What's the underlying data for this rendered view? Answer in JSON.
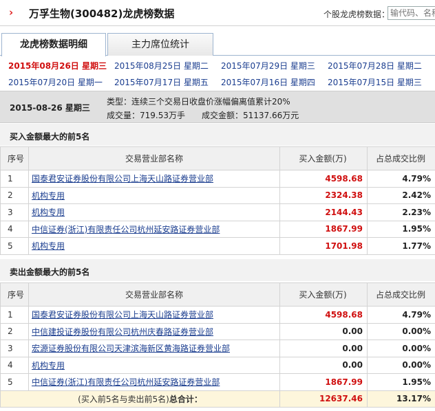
{
  "header": {
    "arrow": "›",
    "stock_name": "万孚生物",
    "stock_code": "(300482)",
    "page_title_suffix": "龙虎榜数据",
    "search_label": "个股龙虎榜数据：",
    "search_placeholder": "输代码、名称"
  },
  "tabs": [
    {
      "label": "龙虎榜数据明细"
    },
    {
      "label": "主力席位统计"
    }
  ],
  "dates": [
    {
      "date": "2015年08月26日",
      "weekday": "星期三"
    },
    {
      "date": "2015年08月25日",
      "weekday": "星期二"
    },
    {
      "date": "2015年07月29日",
      "weekday": "星期三"
    },
    {
      "date": "2015年07月28日",
      "weekday": "星期二"
    },
    {
      "date": "2015年07月20日",
      "weekday": "星期一"
    },
    {
      "date": "2015年07月17日",
      "weekday": "星期五"
    },
    {
      "date": "2015年07月16日",
      "weekday": "星期四"
    },
    {
      "date": "2015年07月15日",
      "weekday": "星期三"
    }
  ],
  "summary": {
    "date": "2015-08-26  星期三",
    "type": "类型：连续三个交易日收盘价涨幅偏离值累计20%",
    "volume": "成交量：719.53万手",
    "amount": "成交金额：51137.66万元"
  },
  "buy": {
    "title": "买入金额最大的前5名",
    "columns": [
      "序号",
      "交易营业部名称",
      "买入金额(万)",
      "占总成交比例"
    ],
    "rows": [
      {
        "idx": "1",
        "name": "国泰君安证券股份有限公司上海天山路证券营业部",
        "amount": "4598.68",
        "pct": "4.79%"
      },
      {
        "idx": "2",
        "name": "机构专用",
        "amount": "2324.38",
        "pct": "2.42%"
      },
      {
        "idx": "3",
        "name": "机构专用",
        "amount": "2144.43",
        "pct": "2.23%"
      },
      {
        "idx": "4",
        "name": "中信证券(浙江)有限责任公司杭州延安路证券营业部",
        "amount": "1867.99",
        "pct": "1.95%"
      },
      {
        "idx": "5",
        "name": "机构专用",
        "amount": "1701.98",
        "pct": "1.77%"
      }
    ]
  },
  "sell": {
    "title": "卖出金额最大的前5名",
    "columns": [
      "序号",
      "交易营业部名称",
      "买入金额(万)",
      "占总成交比例"
    ],
    "rows": [
      {
        "idx": "1",
        "name": "国泰君安证券股份有限公司上海天山路证券营业部",
        "amount": "4598.68",
        "pct": "4.79%"
      },
      {
        "idx": "2",
        "name": "中信建投证券股份有限公司杭州庆春路证券营业部",
        "amount": "0.00",
        "pct": "0.00%"
      },
      {
        "idx": "3",
        "name": "宏源证券股份有限公司天津滨海新区黄海路证券营业部",
        "amount": "0.00",
        "pct": "0.00%"
      },
      {
        "idx": "4",
        "name": "机构专用",
        "amount": "0.00",
        "pct": "0.00%"
      },
      {
        "idx": "5",
        "name": "中信证券(浙江)有限责任公司杭州延安路证券营业部",
        "amount": "1867.99",
        "pct": "1.95%"
      }
    ],
    "total_prefix": "(买入前5名与卖出前5名)",
    "total_label": "总合计：",
    "total_amount": "12637.46",
    "total_pct": "13.17%"
  },
  "colors": {
    "accent_red": "#d01010",
    "link_blue": "#1a3d8f"
  }
}
